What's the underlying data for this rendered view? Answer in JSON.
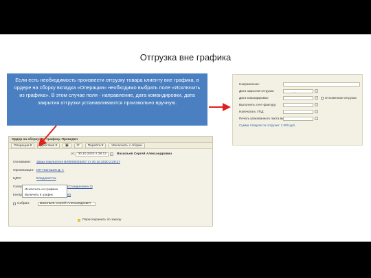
{
  "slide": {
    "title": "Отгрузка вне графика",
    "callout": "Если есть необходимость произвести отгрузку товара клиенту вне графика, в ордере на сборку вкладка «Операции» необходимо выбрать поле «Исключить из графика». В этом случае поля - направление, дата командировки, дата закрытия отгрузки устанавливаются произвольно вручную."
  },
  "right_form": {
    "rows": [
      {
        "label": "Направление:"
      },
      {
        "label": "Дата закрытия отгрузки:"
      },
      {
        "label": "Дата командировки:"
      },
      {
        "label": "Выполнять счет-фактуру:"
      },
      {
        "label": "Напечатать УПД:"
      },
      {
        "label": "Печать упакованного листа вместо накладной"
      }
    ],
    "date_placeholder": ". .",
    "deferred_label": "Отложенная отгрузка",
    "sum_label": "Сумма товаров по отгрузке: 1 000 руб."
  },
  "left_form": {
    "window_title": "Ордер на сборку: По графику. Проведен",
    "toolbar": {
      "operations": "Операции",
      "actions": "Действия",
      "go": "Перейти",
      "exclude_from_assembly": "Исключить с сборки"
    },
    "menu": {
      "item1": "Исключить из графика",
      "item2": "Включить в график"
    },
    "header": {
      "number": "00-00...",
      "from_label": "от:",
      "date": "30.10.2020  2:38:12",
      "responsible": "Васильев Сергей Александрович"
    },
    "rows": [
      {
        "label": "Основание:",
        "value": "Заказ покупателя ВЛ0000025207 от 30.10.2020 2:29:27"
      },
      {
        "label": "Организация:",
        "value": "ИП Тингишев Д. Г."
      },
      {
        "label": "ЦФО:",
        "value": "Владивосток"
      },
      {
        "label": "Склад:",
        "value": "Владивосток",
        "value2": "БАЗА (Стандиновна 3)"
      },
      {
        "label": "Контрагент:",
        "value": "Бастраканова (Мэрия)"
      },
      {
        "label": "Собран:",
        "value": "Васильев Сергей Александрович"
      }
    ],
    "footer": "Пересохранить по заказу"
  }
}
